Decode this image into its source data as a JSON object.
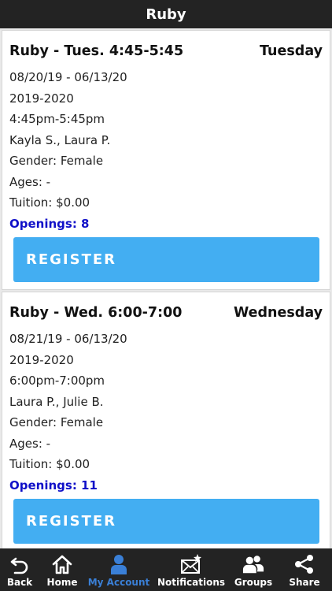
{
  "header": {
    "title": "Ruby"
  },
  "classes": [
    {
      "title": "Ruby - Tues. 4:45-5:45",
      "day": "Tuesday",
      "dates": "08/20/19 - 06/13/20",
      "session": "2019-2020",
      "time": "4:45pm-5:45pm",
      "instructors": "Kayla S., Laura P.",
      "gender": "Gender: Female",
      "ages": "Ages: -",
      "tuition": "Tuition: $0.00",
      "openings": "Openings: 8",
      "register_label": "REGISTER"
    },
    {
      "title": "Ruby - Wed. 6:00-7:00",
      "day": "Wednesday",
      "dates": "08/21/19 - 06/13/20",
      "session": "2019-2020",
      "time": "6:00pm-7:00pm",
      "instructors": "Laura P., Julie B.",
      "gender": "Gender: Female",
      "ages": "Ages: -",
      "tuition": "Tuition: $0.00",
      "openings": "Openings: 11",
      "register_label": "REGISTER"
    }
  ],
  "tabbar": {
    "items": [
      {
        "label": "Back",
        "icon": "back-icon"
      },
      {
        "label": "Home",
        "icon": "home-icon"
      },
      {
        "label": "My Account",
        "icon": "user-icon",
        "active": true
      },
      {
        "label": "Notifications",
        "icon": "mail-star-icon"
      },
      {
        "label": "Groups",
        "icon": "group-icon"
      },
      {
        "label": "Share",
        "icon": "share-icon"
      }
    ]
  },
  "colors": {
    "header_bg": "#232323",
    "register_bg": "#43aef2",
    "openings_text": "#1010c8",
    "active_tab": "#3a7fd6"
  }
}
